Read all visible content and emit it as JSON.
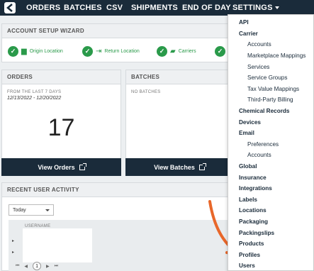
{
  "nav": {
    "items": [
      "ORDERS",
      "BATCHES",
      "CSV",
      "SHIPMENTS",
      "END OF DAY"
    ],
    "settings_label": "SETTINGS"
  },
  "wizard": {
    "title": "ACCOUNT SETUP WIZARD",
    "steps": [
      "Origin Location",
      "Return Location",
      "Carriers"
    ]
  },
  "orders": {
    "title": "ORDERS",
    "range_label": "FROM THE LAST 7 DAYS",
    "date_range": "12/13/2022 - 12/20/2022",
    "count": "17",
    "button": "View Orders"
  },
  "batches": {
    "title": "BATCHES",
    "empty": "NO BATCHES",
    "button": "View Batches"
  },
  "activity": {
    "title": "RECENT USER ACTIVITY",
    "filter": "Today",
    "column": "USERNAME",
    "page": "1"
  },
  "settings_menu": [
    {
      "label": "API",
      "level": "top"
    },
    {
      "label": "Carrier",
      "level": "top"
    },
    {
      "label": "Accounts",
      "level": "sub"
    },
    {
      "label": "Marketplace Mappings",
      "level": "sub"
    },
    {
      "label": "Services",
      "level": "sub"
    },
    {
      "label": "Service Groups",
      "level": "sub"
    },
    {
      "label": "Tax Value Mappings",
      "level": "sub"
    },
    {
      "label": "Third-Party Billing",
      "level": "sub"
    },
    {
      "label": "Chemical Records",
      "level": "top"
    },
    {
      "label": "Devices",
      "level": "top"
    },
    {
      "label": "Email",
      "level": "top"
    },
    {
      "label": "Preferences",
      "level": "sub"
    },
    {
      "label": "Accounts",
      "level": "sub"
    },
    {
      "label": "Global",
      "level": "top"
    },
    {
      "label": "Insurance",
      "level": "top"
    },
    {
      "label": "Integrations",
      "level": "top"
    },
    {
      "label": "Labels",
      "level": "top"
    },
    {
      "label": "Locations",
      "level": "top"
    },
    {
      "label": "Packaging",
      "level": "top"
    },
    {
      "label": "Packingslips",
      "level": "top"
    },
    {
      "label": "Products",
      "level": "top"
    },
    {
      "label": "Profiles",
      "level": "top"
    },
    {
      "label": "Users",
      "level": "top"
    }
  ],
  "colors": {
    "nav_bg": "#1a2b3a",
    "success": "#2a9a4a",
    "annotation_arrow": "#e8672a"
  }
}
